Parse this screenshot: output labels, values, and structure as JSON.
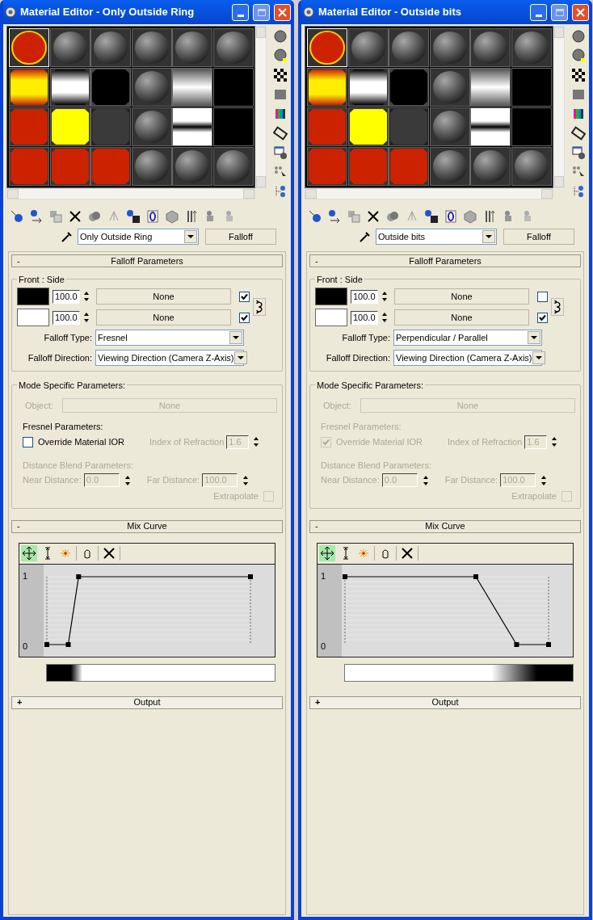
{
  "windows": [
    {
      "title": "Material Editor - Only Outside Ring",
      "slots": [
        {
          "kind": "red-ring",
          "selected": true
        },
        {
          "kind": "sphere",
          "selected": false
        },
        {
          "kind": "sphere",
          "selected": false
        },
        {
          "kind": "sphere",
          "selected": false
        },
        {
          "kind": "sphere",
          "selected": false
        },
        {
          "kind": "sphere",
          "selected": false
        },
        {
          "kind": "fire-band",
          "selected": false
        },
        {
          "kind": "bw-band",
          "selected": false
        },
        {
          "kind": "black",
          "selected": false
        },
        {
          "kind": "sphere",
          "selected": false
        },
        {
          "kind": "gray-gradient",
          "selected": false
        },
        {
          "kind": "black-square",
          "selected": false
        },
        {
          "kind": "red",
          "selected": false
        },
        {
          "kind": "yellow",
          "selected": false
        },
        {
          "kind": "dark",
          "selected": false
        },
        {
          "kind": "sphere",
          "selected": false
        },
        {
          "kind": "inverse-band",
          "selected": false
        },
        {
          "kind": "black-square",
          "selected": false
        },
        {
          "kind": "red",
          "selected": false
        },
        {
          "kind": "red",
          "selected": false
        },
        {
          "kind": "red",
          "selected": false
        },
        {
          "kind": "sphere",
          "selected": false
        },
        {
          "kind": "sphere",
          "selected": false
        },
        {
          "kind": "sphere",
          "selected": false
        }
      ],
      "material_name": "Only Outside Ring",
      "material_type": "Falloff",
      "rollouts": [
        {
          "kind": "falloff",
          "title": "Falloff Parameters",
          "toggle": "-",
          "expanded": true,
          "front_side": {
            "label": "Front : Side",
            "rows": [
              {
                "color": "#000000",
                "amount": "100.0",
                "map": "None",
                "checked": true
              },
              {
                "color": "#ffffff",
                "amount": "100.0",
                "map": "None",
                "checked": true
              }
            ]
          },
          "falloff_type": {
            "label": "Falloff Type:",
            "value": "Fresnel"
          },
          "falloff_direction": {
            "label": "Falloff Direction:",
            "value": "Viewing Direction (Camera Z-Axis)"
          },
          "mode": {
            "label": "Mode Specific Parameters:",
            "object": {
              "label": "Object:",
              "value": "None",
              "disabled": true
            },
            "fresnel": {
              "label": "Fresnel Parameters:",
              "disabled": false,
              "override": {
                "label": "Override Material IOR",
                "checked": false
              },
              "ior": {
                "label": "Index of Refraction",
                "value": "1.6",
                "disabled": true
              }
            },
            "distance": {
              "label": "Distance Blend Parameters:",
              "disabled": true,
              "near": {
                "label": "Near Distance:",
                "value": "0.0"
              },
              "far": {
                "label": "Far Distance:",
                "value": "100.0"
              },
              "extrapolate": {
                "label": "Extrapolate",
                "checked": false
              }
            }
          }
        },
        {
          "kind": "mix_curve",
          "title": "Mix Curve",
          "toggle": "-",
          "expanded": true,
          "axis_labels": [
            "1",
            "0"
          ],
          "curve": {
            "kind": "ramp-up"
          }
        },
        {
          "title": "Output",
          "toggle": "+",
          "expanded": false
        }
      ]
    },
    {
      "title": "Material Editor - Outside bits",
      "slots": [
        {
          "kind": "red-ring",
          "selected": true
        },
        {
          "kind": "sphere",
          "selected": false
        },
        {
          "kind": "sphere",
          "selected": false
        },
        {
          "kind": "sphere",
          "selected": false
        },
        {
          "kind": "sphere",
          "selected": false
        },
        {
          "kind": "sphere",
          "selected": false
        },
        {
          "kind": "fire-band",
          "selected": false
        },
        {
          "kind": "bw-band",
          "selected": false
        },
        {
          "kind": "black",
          "selected": false
        },
        {
          "kind": "sphere",
          "selected": false
        },
        {
          "kind": "gray-gradient",
          "selected": false
        },
        {
          "kind": "black-square",
          "selected": false
        },
        {
          "kind": "red",
          "selected": false
        },
        {
          "kind": "yellow",
          "selected": false
        },
        {
          "kind": "dark",
          "selected": false
        },
        {
          "kind": "sphere",
          "selected": false
        },
        {
          "kind": "inverse-band",
          "selected": false
        },
        {
          "kind": "black-square",
          "selected": false
        },
        {
          "kind": "red",
          "selected": false
        },
        {
          "kind": "red",
          "selected": false
        },
        {
          "kind": "red",
          "selected": false
        },
        {
          "kind": "sphere",
          "selected": false
        },
        {
          "kind": "sphere",
          "selected": false
        },
        {
          "kind": "sphere",
          "selected": false
        }
      ],
      "material_name": "Outside bits",
      "material_type": "Falloff",
      "rollouts": [
        {
          "kind": "falloff",
          "title": "Falloff Parameters",
          "toggle": "-",
          "expanded": true,
          "front_side": {
            "label": "Front : Side",
            "rows": [
              {
                "color": "#000000",
                "amount": "100.0",
                "map": "None",
                "checked": false
              },
              {
                "color": "#ffffff",
                "amount": "100.0",
                "map": "None",
                "checked": true
              }
            ]
          },
          "falloff_type": {
            "label": "Falloff Type:",
            "value": "Perpendicular / Parallel"
          },
          "falloff_direction": {
            "label": "Falloff Direction:",
            "value": "Viewing Direction (Camera Z-Axis)"
          },
          "mode": {
            "label": "Mode Specific Parameters:",
            "object": {
              "label": "Object:",
              "value": "None",
              "disabled": true
            },
            "fresnel": {
              "label": "Fresnel Parameters:",
              "disabled": true,
              "override": {
                "label": "Override Material IOR",
                "checked": true
              },
              "ior": {
                "label": "Index of Refraction",
                "value": "1.6",
                "disabled": true
              }
            },
            "distance": {
              "label": "Distance Blend Parameters:",
              "disabled": true,
              "near": {
                "label": "Near Distance:",
                "value": "0.0"
              },
              "far": {
                "label": "Far Distance:",
                "value": "100.0"
              },
              "extrapolate": {
                "label": "Extrapolate",
                "checked": false
              }
            }
          }
        },
        {
          "kind": "mix_curve",
          "title": "Mix Curve",
          "toggle": "-",
          "expanded": true,
          "axis_labels": [
            "1",
            "0"
          ],
          "curve": {
            "kind": "ramp-down"
          }
        },
        {
          "title": "Output",
          "toggle": "+",
          "expanded": false
        }
      ]
    }
  ]
}
